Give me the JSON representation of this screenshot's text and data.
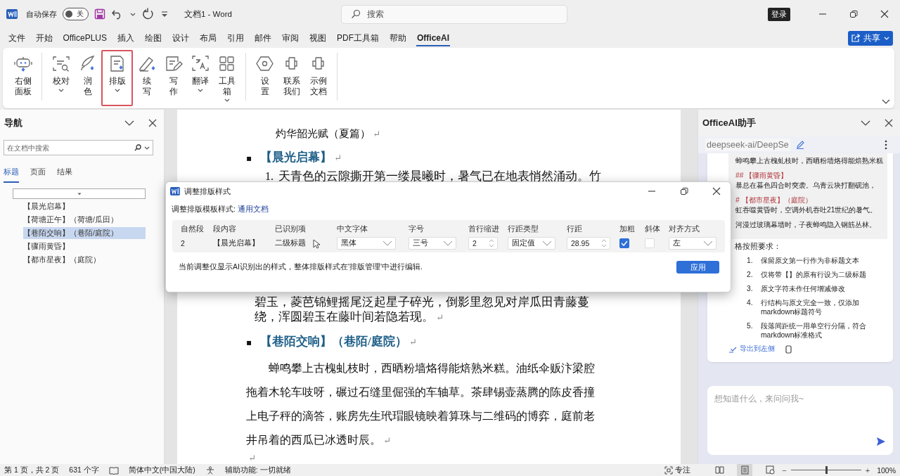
{
  "titlebar": {
    "autosave_label": "自动保存",
    "autosave": {
      "on": false,
      "label": "关"
    },
    "title": "文档1 - Word",
    "search_placeholder": "搜索",
    "login": "登录"
  },
  "menu_tabs": [
    {
      "label": "文件",
      "selected": false
    },
    {
      "label": "开始",
      "selected": false
    },
    {
      "label": "OfficePLUS",
      "selected": false
    },
    {
      "label": "插入",
      "selected": false
    },
    {
      "label": "绘图",
      "selected": false
    },
    {
      "label": "设计",
      "selected": false
    },
    {
      "label": "布局",
      "selected": false
    },
    {
      "label": "引用",
      "selected": false
    },
    {
      "label": "邮件",
      "selected": false
    },
    {
      "label": "审阅",
      "selected": false
    },
    {
      "label": "视图",
      "selected": false
    },
    {
      "label": "PDF工具箱",
      "selected": false
    },
    {
      "label": "帮助",
      "selected": false
    },
    {
      "label": "OfficeAI",
      "selected": true
    }
  ],
  "share": "共享",
  "ribbon": {
    "groups": [
      [
        {
          "lines": [
            "右侧",
            "面板"
          ],
          "highlighted": false
        }
      ],
      [
        {
          "lines": [
            "校对"
          ],
          "caret": true,
          "highlighted": false
        },
        {
          "lines": [
            "润",
            "色"
          ],
          "highlighted": false
        },
        {
          "lines": [
            "排版"
          ],
          "caret": true,
          "highlighted": true
        },
        {
          "lines": [
            "续",
            "写"
          ],
          "highlighted": false
        },
        {
          "lines": [
            "写",
            "作"
          ],
          "highlighted": false
        },
        {
          "lines": [
            "翻译"
          ],
          "caret": true,
          "highlighted": false
        },
        {
          "lines": [
            "工具",
            "箱"
          ],
          "caret": true,
          "caret_inline": true,
          "highlighted": false
        }
      ],
      [
        {
          "lines": [
            "设",
            "置"
          ],
          "highlighted": false
        },
        {
          "lines": [
            "联系",
            "我们"
          ],
          "highlighted": false
        },
        {
          "lines": [
            "示例",
            "文档"
          ],
          "highlighted": false
        }
      ]
    ]
  },
  "navigation": {
    "title": "导航",
    "search_placeholder": "在文档中搜索",
    "tabs": [
      {
        "label": "标题",
        "selected": true
      },
      {
        "label": "页面",
        "selected": false
      },
      {
        "label": "结果",
        "selected": false
      }
    ],
    "headings": [
      {
        "text": "【晨光启幕】",
        "selected": false
      },
      {
        "text": "【荷塘正午】（荷塘/瓜田）",
        "selected": false
      },
      {
        "text": "【巷陌交响】（巷陌/庭院）",
        "selected": true
      },
      {
        "text": "【骤雨黄昏】",
        "selected": false
      },
      {
        "text": "【都市星夜】（庭院）",
        "selected": false
      }
    ]
  },
  "document": {
    "paragraphs": [
      {
        "kind": "plain",
        "text": "灼华韶光赋（夏篇）",
        "mark": "↵"
      },
      {
        "kind": "heading",
        "bullet": "▪",
        "text": "【晨光启幕】",
        "mark": "↵"
      },
      {
        "kind": "numbered",
        "number": "1.",
        "text": "天青色的云隙撕开第一缕晨曦时，暑气已在地表悄然涌动。竹"
      },
      {
        "kind": "continuation",
        "text": "碧玉，菱芭锦鲤摇尾泛起星子碎光，倒影里忽见对岸瓜田青藤蔓绕，浑圆碧玉在藤叶间若隐若现。",
        "mark": "↵"
      },
      {
        "kind": "heading",
        "bullet": "▪",
        "text": "【巷陌交响】（巷陌/庭院）",
        "mark": "↵"
      },
      {
        "kind": "body",
        "text": "蝉鸣攀上古槐虬枝时，西晒粉墙烙得能焙熟米糕。油纸伞贩汴梁腔拖着木轮车吱呀，碾过石缝里倔强的车轴草。茶肆锡壶蒸腾的陈皮香撞上电子秤的滴答，账房先生玳瑁眼镜映着算珠与二维码的博弈，庭前老井吊着的西瓜已冰透时辰。",
        "mark": "↵"
      },
      {
        "kind": "empty",
        "mark": "↵"
      }
    ]
  },
  "assistant": {
    "title": "OfficeAI助手",
    "model": "deepseek-ai/DeepSe",
    "quote": [
      {
        "kind": "text",
        "text": "蝉鸣攀上古槐虬枝时，西晒粉墙烙得能焙熟米糕"
      },
      {
        "kind": "heading",
        "text": "## 【骤雨黄昏】"
      },
      {
        "kind": "text",
        "text": "暴总在暮色四合时突袭。乌青云块打翻砚池，"
      },
      {
        "kind": "heading",
        "text": "# 【都市星夜】（庭院）"
      },
      {
        "kind": "text",
        "text": "虹吞噬黄昏时，空调外机吞吐21世纪的暑气。"
      },
      {
        "kind": "text",
        "text": "河漫过玻璃幕墙时，子夜蝉鸣隐入钢筋丛林。"
      }
    ],
    "intro": "格按照要求：",
    "steps": [
      {
        "number": "1.",
        "text": "保留原文第一行作为非标题文本"
      },
      {
        "number": "2.",
        "text": "仅将带【】的原有行设为二级标题"
      },
      {
        "number": "3.",
        "text": "原文字符未作任何增减修改"
      },
      {
        "number": "4.",
        "text": "行结构与原文完全一致，仅添加markdown标题符号"
      },
      {
        "number": "5.",
        "text": "段落间距统一用单空行分隔，符合markdown标准格式"
      }
    ],
    "export_link": "导出到左侧",
    "input_placeholder": "想知道什么，来问问我~"
  },
  "dialog": {
    "title": "调整排版样式",
    "template_label": "调整排版模板样式:",
    "template_link": "通用文档",
    "columns": [
      "自然段",
      "段内容",
      "已识别项",
      "中文字体",
      "字号",
      "首行缩进",
      "行距类型",
      "行距",
      "加粗",
      "斜体",
      "对齐方式"
    ],
    "row": [
      {
        "kind": "text",
        "value": "2"
      },
      {
        "kind": "text",
        "value": "【晨光启幕】"
      },
      {
        "kind": "text",
        "value": "二级标题"
      },
      {
        "kind": "select",
        "value": "黑体"
      },
      {
        "kind": "select",
        "value": "三号"
      },
      {
        "kind": "spinner",
        "value": "2"
      },
      {
        "kind": "select",
        "value": "固定值"
      },
      {
        "kind": "spinner",
        "value": "28.95"
      },
      {
        "kind": "checkbox",
        "checked": true
      },
      {
        "kind": "checkbox",
        "checked": false
      },
      {
        "kind": "select",
        "value": "左"
      }
    ],
    "note": "当前调整仅显示AI识别出的样式，整体排版样式在'排版管理'中进行编辑.",
    "apply": "应用"
  },
  "status_bar": {
    "page": "第 1 页，共 2 页",
    "words": "631 个字",
    "language": "简体中文(中国大陆)",
    "accessibility": "辅助功能: 一切就绪",
    "focus": "专注",
    "views": [
      {
        "selected": false
      },
      {
        "selected": true
      },
      {
        "selected": false
      }
    ],
    "zoom_out": "−",
    "zoom_in": "+",
    "zoom": {
      "level": 0.5
    },
    "zoom_label": "100%"
  }
}
